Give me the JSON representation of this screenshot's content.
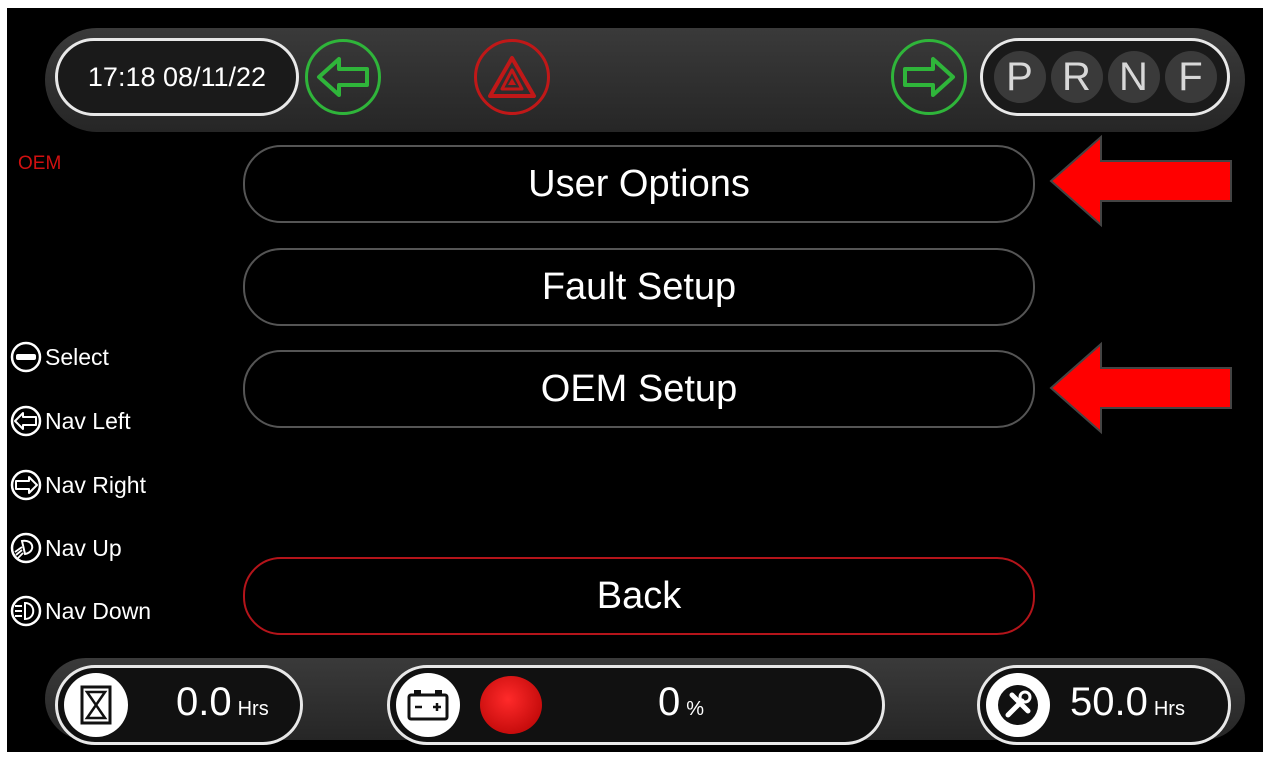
{
  "header": {
    "datetime": "17:18 08/11/22",
    "gears": [
      "P",
      "R",
      "N",
      "F"
    ]
  },
  "screen_tag": "OEM",
  "menu": {
    "items": [
      {
        "label": "User Options"
      },
      {
        "label": "Fault Setup"
      },
      {
        "label": "OEM Setup"
      }
    ],
    "back_label": "Back"
  },
  "legend": [
    {
      "label": "Select",
      "icon": "select-icon"
    },
    {
      "label": "Nav Left",
      "icon": "arrow-left-icon"
    },
    {
      "label": "Nav Right",
      "icon": "arrow-right-icon"
    },
    {
      "label": "Nav Up",
      "icon": "headlight-high-icon"
    },
    {
      "label": "Nav Down",
      "icon": "headlight-low-icon"
    }
  ],
  "footer": {
    "hours": {
      "value": "0.0",
      "unit": "Hrs",
      "icon": "hourglass-icon"
    },
    "battery": {
      "value": "0",
      "unit": "%",
      "icon": "battery-icon",
      "status_color": "#e01010"
    },
    "service": {
      "value": "50.0",
      "unit": "Hrs",
      "icon": "wrench-icon"
    }
  },
  "colors": {
    "accent_green": "#2fb53a",
    "hazard_red": "#c01818",
    "arrow_red": "#ff0000",
    "back_border": "#b4141a"
  }
}
